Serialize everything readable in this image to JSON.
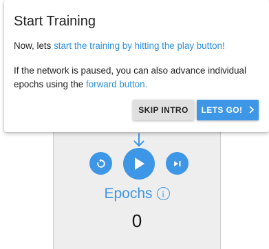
{
  "dialog": {
    "title": "Start Training",
    "para1_prefix": "Now, lets ",
    "para1_link": "start the training by hitting the play button!",
    "para2_prefix": "If the network is paused, you can also advance individual epochs using the ",
    "para2_link": "forward button.",
    "skip_label": "SKIP INTRO",
    "go_label": "LETS GO!",
    "go_icon": "chevron-right-icon"
  },
  "controls": {
    "epochs_label": "Epochs",
    "info_glyph": "i",
    "epochs_value": "0",
    "icons": [
      "arrow-down-icon",
      "reset-icon",
      "play-icon",
      "step-forward-icon",
      "info-icon"
    ]
  },
  "colors": {
    "accent": "#3d96e6",
    "link": "#2d8fe0",
    "panel_bg": "#eeeeee",
    "skip_bg": "#e0e0e0"
  }
}
